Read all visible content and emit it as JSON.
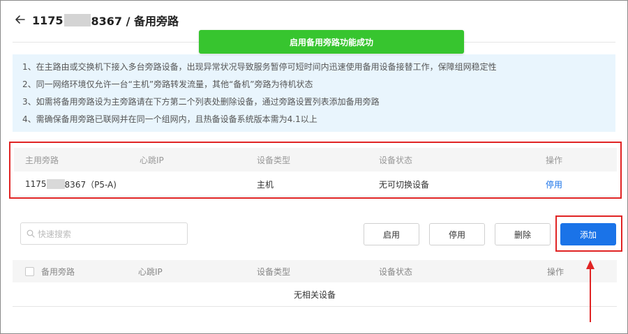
{
  "header": {
    "title_prefix": "1175",
    "title_suffix": "8367 / 备用旁路"
  },
  "toast": {
    "message": "启用备用旁路功能成功"
  },
  "info": {
    "lines": [
      "1、在主路由或交换机下接入多台旁路设备，出现异常状况导致服务暂停可短时间内迅速使用备用设备接替工作，保障组网稳定性",
      "2、同一网络环境仅允许一台“主机”旁路转发流量，其他“备机”旁路为待机状态",
      "3、如需将备用旁路设为主旁路请在下方第二个列表处删除设备，通过旁路设置列表添加备用旁路",
      "4、需确保备用旁路已联网并在同一个组网内，且热备设备系统版本需为4.1以上"
    ]
  },
  "main_table": {
    "columns": [
      "主用旁路",
      "心跳IP",
      "设备类型",
      "设备状态",
      "操作"
    ],
    "row": {
      "name_prefix": "1175",
      "name_suffix": "8367（P5-A)",
      "heartbeat_ip": "",
      "device_type": "主机",
      "device_status": "无可切换设备",
      "action": "停用"
    }
  },
  "toolbar": {
    "search_placeholder": "快速搜索",
    "enable_label": "启用",
    "disable_label": "停用",
    "delete_label": "删除",
    "add_label": "添加"
  },
  "backup_table": {
    "columns": [
      "备用旁路",
      "心跳IP",
      "设备类型",
      "设备状态",
      "操作"
    ],
    "empty_text": "无相关设备"
  },
  "colors": {
    "toast_bg": "#37c52f",
    "primary": "#1a73e8",
    "highlight": "#e02424",
    "info_bg": "#e9f5fd"
  }
}
